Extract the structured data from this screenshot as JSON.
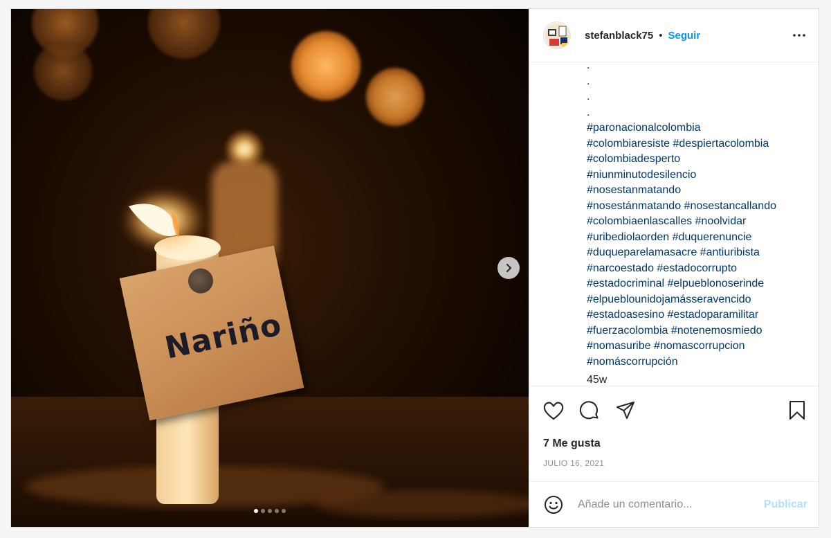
{
  "post": {
    "username": "stefanblack75",
    "separator": "•",
    "follow_label": "Seguir",
    "image_text": "Nariño",
    "carousel": {
      "count": 5,
      "active_index": 0
    },
    "caption": {
      "dots": [
        ".",
        ".",
        ".",
        "."
      ],
      "hashtag_lines": [
        "#paronacionalcolombia",
        "#colombiaresiste #despiertacolombia",
        "#colombiadesperto",
        "#niunminutodesilencio",
        "#nosestanmatando",
        "#nosestánmatando #nosestancallando",
        "#colombiaenlascalles #noolvidar",
        "#uribediolaorden #duquerenuncie",
        "#duqueparelamasacre #antiuribista",
        "#narcoestado #estadocorrupto",
        "#estadocriminal #elpueblonoserinde",
        "#elpueblounidojamásseravencido",
        "#estadoasesino #estadoparamilitar",
        "#fuerzacolombia #notenemosmiedo",
        "#nomasuribe #nomascorrupcion",
        "#nomáscorrupción"
      ],
      "cut_line": "45w"
    },
    "likes_text": "7 Me gusta",
    "date_text": "JULIO 16, 2021",
    "comment": {
      "placeholder": "Añade un comentario...",
      "value": ""
    },
    "publish_label": "Publicar"
  },
  "icons": {
    "more": "more-horizontal-icon",
    "next": "chevron-right-icon",
    "like": "heart-icon",
    "comment": "comment-icon",
    "share": "paper-plane-icon",
    "save": "bookmark-icon",
    "emoji": "smiley-icon"
  },
  "colors": {
    "link": "#00376b",
    "follow": "#0095f6",
    "publish_disabled": "#b2dffc",
    "muted": "#8e8e8e"
  }
}
